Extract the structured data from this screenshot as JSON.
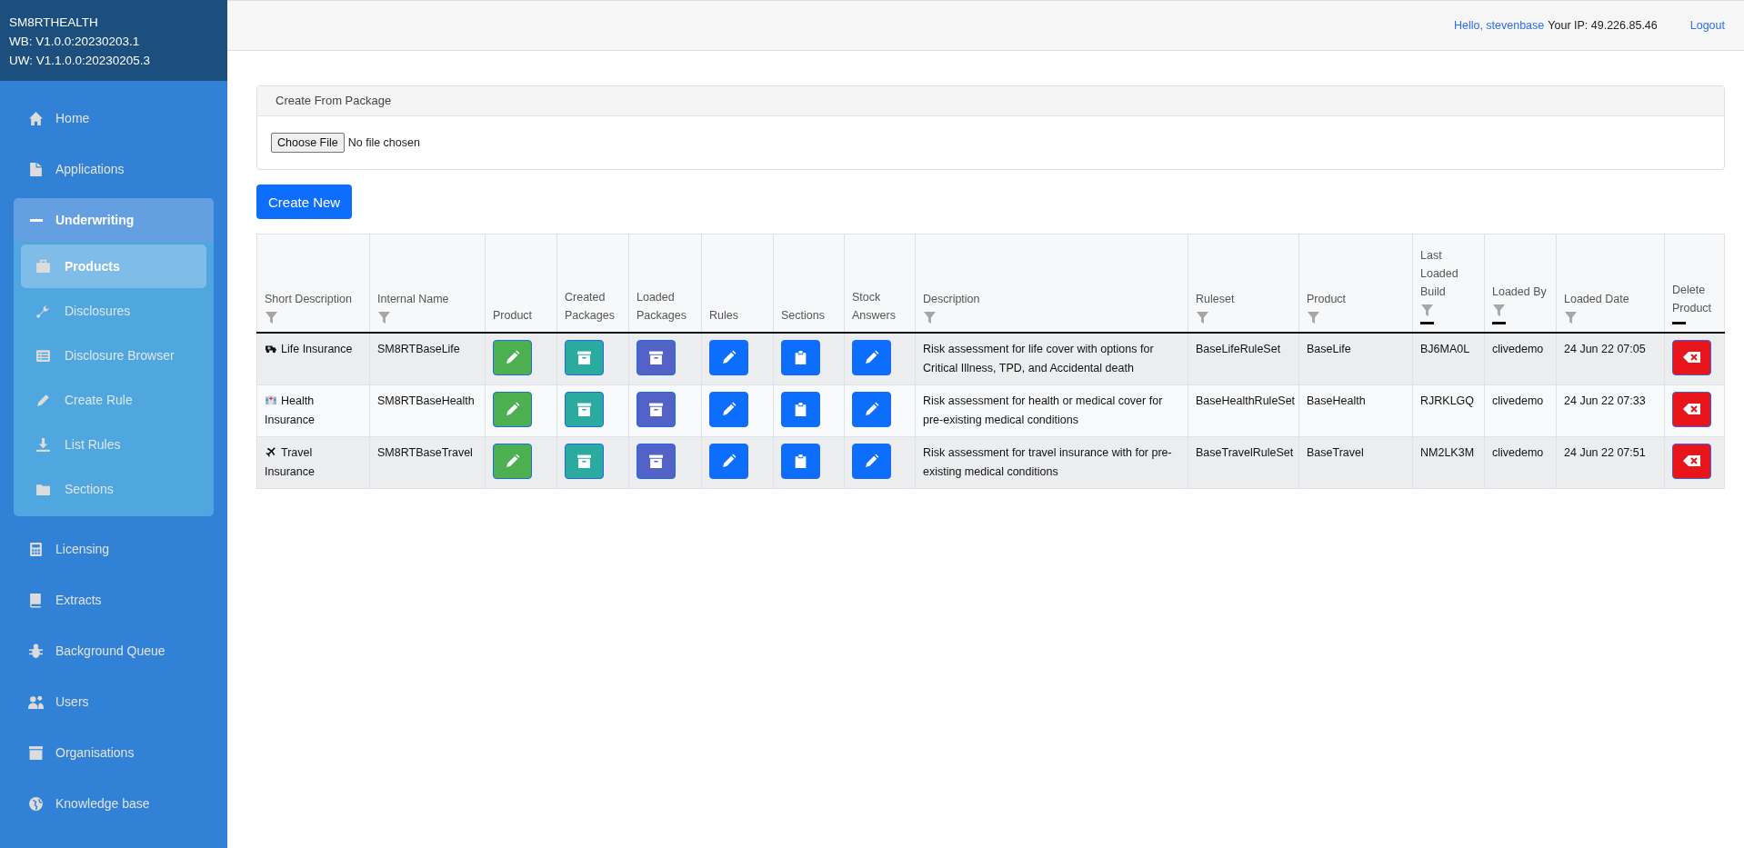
{
  "brand": {
    "name": "SM8RTHEALTH",
    "versions": [
      "WB: V1.0.0:20230203.1",
      "UW: V1.1.0.0:20230205.3"
    ]
  },
  "sidebar": {
    "items": [
      {
        "label": "Home",
        "selected": false
      },
      {
        "label": "Applications",
        "selected": false
      },
      {
        "label": "Underwriting",
        "selected": false,
        "expanded": true,
        "children": [
          {
            "label": "Products",
            "selected": true
          },
          {
            "label": "Disclosures",
            "selected": false
          },
          {
            "label": "Disclosure Browser",
            "selected": false
          },
          {
            "label": "Create Rule",
            "selected": false
          },
          {
            "label": "List Rules",
            "selected": false
          },
          {
            "label": "Sections",
            "selected": false
          }
        ]
      },
      {
        "label": "Licensing",
        "selected": false
      },
      {
        "label": "Extracts",
        "selected": false
      },
      {
        "label": "Background Queue",
        "selected": false
      },
      {
        "label": "Users",
        "selected": false
      },
      {
        "label": "Organisations",
        "selected": false
      },
      {
        "label": "Knowledge base",
        "selected": false
      }
    ]
  },
  "topbar": {
    "greeting": "Hello, stevenbase",
    "ip": "Your IP: 49.226.85.46",
    "logout": "Logout"
  },
  "package_card": {
    "title": "Create From Package",
    "file_button": "Choose File",
    "file_status": "No file chosen"
  },
  "create_button": "Create New",
  "table": {
    "columns": [
      {
        "label": "Short Description",
        "kind": "text",
        "filter": true,
        "dash": false
      },
      {
        "label": "Internal Name",
        "kind": "text",
        "filter": true,
        "dash": false
      },
      {
        "label": "Product",
        "kind": "edit",
        "color": "#4caf50",
        "filter": false,
        "dash": false
      },
      {
        "label": "Created Packages",
        "kind": "box",
        "color": "#2bab9f",
        "filter": false,
        "dash": false
      },
      {
        "label": "Loaded Packages",
        "kind": "box",
        "color": "#5362c6",
        "filter": false,
        "dash": false
      },
      {
        "label": "Rules",
        "kind": "edit",
        "color": "#0d6efd",
        "filter": false,
        "dash": false
      },
      {
        "label": "Sections",
        "kind": "clipboard",
        "color": "#0d6efd",
        "filter": false,
        "dash": false
      },
      {
        "label": "Stock Answers",
        "kind": "edit",
        "color": "#0d6efd",
        "filter": false,
        "dash": false
      },
      {
        "label": "Description",
        "kind": "text",
        "filter": true,
        "dash": false
      },
      {
        "label": "Ruleset",
        "kind": "text",
        "filter": true,
        "dash": false
      },
      {
        "label": "Product",
        "kind": "text",
        "filter": true,
        "dash": false
      },
      {
        "label": "Last Loaded Build",
        "kind": "text",
        "filter": true,
        "dash": true
      },
      {
        "label": "Loaded By",
        "kind": "text",
        "filter": true,
        "dash": true
      },
      {
        "label": "Loaded Date",
        "kind": "text",
        "filter": true,
        "dash": false
      },
      {
        "label": "Delete Product",
        "kind": "delete",
        "color": "#e8151b",
        "filter": false,
        "dash": true
      }
    ],
    "rows": [
      {
        "cells": [
          "Life Insurance",
          "SM8RTBaseLife",
          "",
          "",
          "",
          "",
          "",
          "",
          "Risk assessment for life cover with options for Critical Illness, TPD, and Accidental death",
          "BaseLifeRuleSet",
          "BaseLife",
          "BJ6MA0L",
          "clivedemo",
          "24 Jun 22 07:05",
          ""
        ]
      },
      {
        "cells": [
          "Health Insurance",
          "SM8RTBaseHealth",
          "",
          "",
          "",
          "",
          "",
          "",
          "Risk assessment for health or medical cover for pre-existing medical conditions",
          "BaseHealthRuleSet",
          "BaseHealth",
          "RJRKLGQ",
          "clivedemo",
          "24 Jun 22 07:33",
          ""
        ]
      },
      {
        "cells": [
          "Travel Insurance",
          "SM8RTBaseTravel",
          "",
          "",
          "",
          "",
          "",
          "",
          "Risk assessment for travel insurance with for pre-existing medical conditions",
          "BaseTravelRuleSet",
          "BaseTravel",
          "NM2LK3M",
          "clivedemo",
          "24 Jun 22 07:51",
          ""
        ]
      }
    ]
  }
}
